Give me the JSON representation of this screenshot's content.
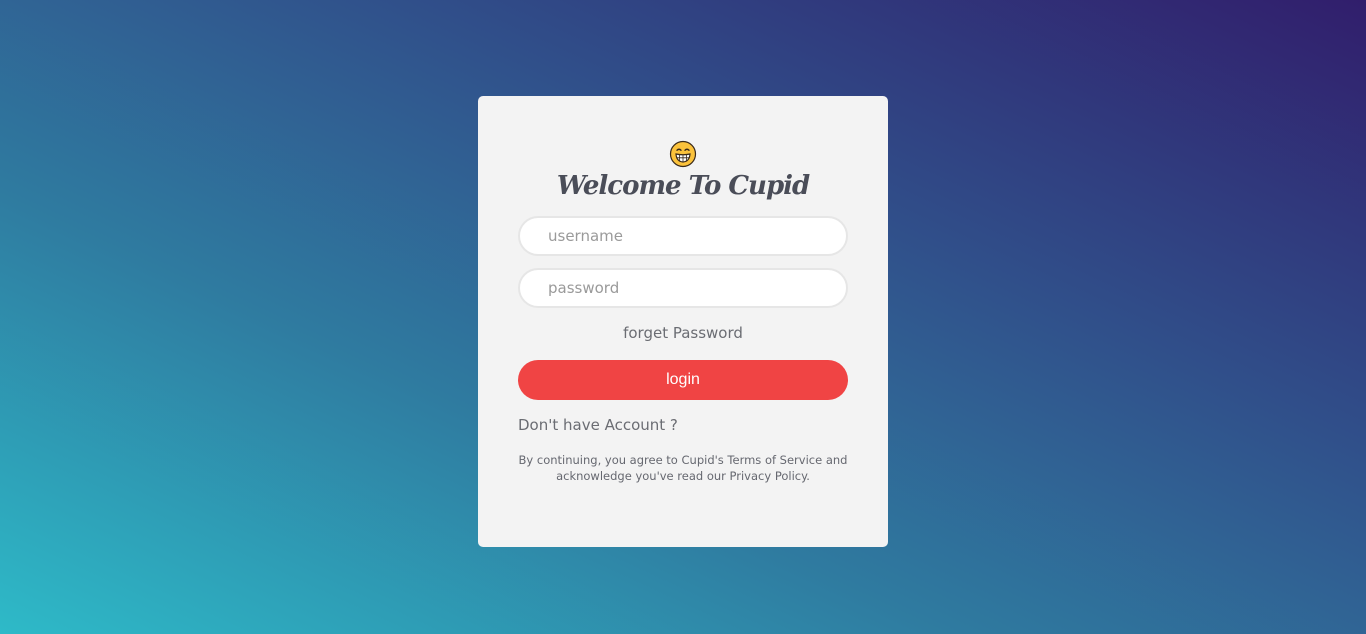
{
  "login_card": {
    "logo_icon": "grinning-emoji-icon",
    "title": "Welcome To Cupid",
    "username_placeholder": "username",
    "password_placeholder": "password",
    "forget_password_label": "forget Password",
    "login_button_label": "login",
    "signup_prompt": "Don't have Account ?",
    "legal_line_1": "By continuing, you agree to Cupid's Terms of Service and",
    "legal_line_2": "acknowledge you've read our Privacy Policy."
  },
  "colors": {
    "login_button": "#f04444",
    "card_background": "#f3f3f3",
    "gradient_start": "#2ebac8",
    "gradient_end": "#311e6c"
  }
}
